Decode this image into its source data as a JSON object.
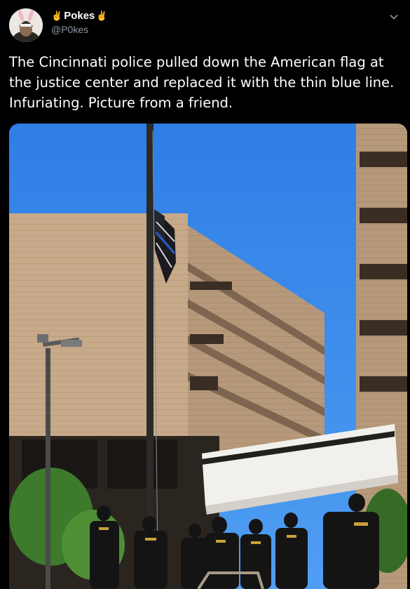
{
  "author": {
    "display_name": "Pokes",
    "handle": "@P0kes",
    "emoji_left": "✌",
    "emoji_right": "✌"
  },
  "tweet": {
    "text": "The Cincinnati police pulled down the American flag at the justice center and replaced it with the thin blue line. Infuriating. Picture from a friend."
  },
  "colors": {
    "background": "#000000",
    "text": "#ffffff",
    "handle": "#8b98a5",
    "sky": "#2e7fe8"
  },
  "icons": {
    "menu": "chevron-down-icon",
    "victory_hand": "victory-hand-icon"
  }
}
